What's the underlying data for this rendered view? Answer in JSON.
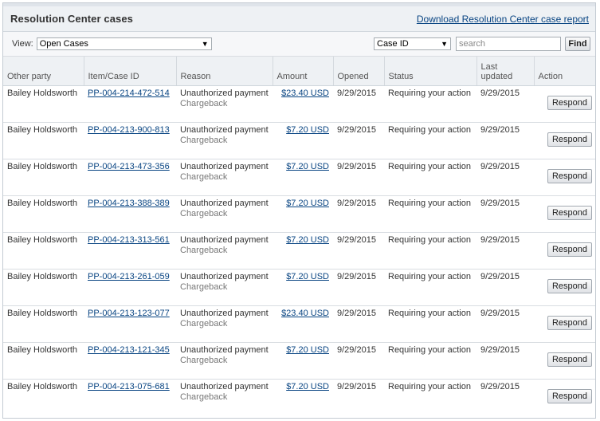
{
  "header": {
    "title": "Resolution Center cases",
    "download_link": "Download Resolution Center case report"
  },
  "filters": {
    "view_label": "View:",
    "view_selected": "Open Cases",
    "search_by_selected": "Case ID",
    "search_placeholder": "search",
    "find_label": "Find"
  },
  "table": {
    "columns": {
      "other_party": "Other party",
      "item_case_id": "Item/Case ID",
      "reason": "Reason",
      "amount": "Amount",
      "opened": "Opened",
      "status": "Status",
      "last_updated": "Last updated",
      "action": "Action"
    },
    "rows": [
      {
        "party": "Bailey Holdsworth",
        "case_id": "PP-004-214-472-514",
        "reason": "Unauthorized payment",
        "reason_sub": "Chargeback",
        "amount": "$23.40 USD",
        "opened": "9/29/2015",
        "status": "Requiring your action",
        "updated": "9/29/2015",
        "action": "Respond"
      },
      {
        "party": "Bailey Holdsworth",
        "case_id": "PP-004-213-900-813",
        "reason": "Unauthorized payment",
        "reason_sub": "Chargeback",
        "amount": "$7.20 USD",
        "opened": "9/29/2015",
        "status": "Requiring your action",
        "updated": "9/29/2015",
        "action": "Respond"
      },
      {
        "party": "Bailey Holdsworth",
        "case_id": "PP-004-213-473-356",
        "reason": "Unauthorized payment",
        "reason_sub": "Chargeback",
        "amount": "$7.20 USD",
        "opened": "9/29/2015",
        "status": "Requiring your action",
        "updated": "9/29/2015",
        "action": "Respond"
      },
      {
        "party": "Bailey Holdsworth",
        "case_id": "PP-004-213-388-389",
        "reason": "Unauthorized payment",
        "reason_sub": "Chargeback",
        "amount": "$7.20 USD",
        "opened": "9/29/2015",
        "status": "Requiring your action",
        "updated": "9/29/2015",
        "action": "Respond"
      },
      {
        "party": "Bailey Holdsworth",
        "case_id": "PP-004-213-313-561",
        "reason": "Unauthorized payment",
        "reason_sub": "Chargeback",
        "amount": "$7.20 USD",
        "opened": "9/29/2015",
        "status": "Requiring your action",
        "updated": "9/29/2015",
        "action": "Respond"
      },
      {
        "party": "Bailey Holdsworth",
        "case_id": "PP-004-213-261-059",
        "reason": "Unauthorized payment",
        "reason_sub": "Chargeback",
        "amount": "$7.20 USD",
        "opened": "9/29/2015",
        "status": "Requiring your action",
        "updated": "9/29/2015",
        "action": "Respond"
      },
      {
        "party": "Bailey Holdsworth",
        "case_id": "PP-004-213-123-077",
        "reason": "Unauthorized payment",
        "reason_sub": "Chargeback",
        "amount": "$23.40 USD",
        "opened": "9/29/2015",
        "status": "Requiring your action",
        "updated": "9/29/2015",
        "action": "Respond"
      },
      {
        "party": "Bailey Holdsworth",
        "case_id": "PP-004-213-121-345",
        "reason": "Unauthorized payment",
        "reason_sub": "Chargeback",
        "amount": "$7.20 USD",
        "opened": "9/29/2015",
        "status": "Requiring your action",
        "updated": "9/29/2015",
        "action": "Respond"
      },
      {
        "party": "Bailey Holdsworth",
        "case_id": "PP-004-213-075-681",
        "reason": "Unauthorized payment",
        "reason_sub": "Chargeback",
        "amount": "$7.20 USD",
        "opened": "9/29/2015",
        "status": "Requiring your action",
        "updated": "9/29/2015",
        "action": "Respond"
      }
    ]
  }
}
